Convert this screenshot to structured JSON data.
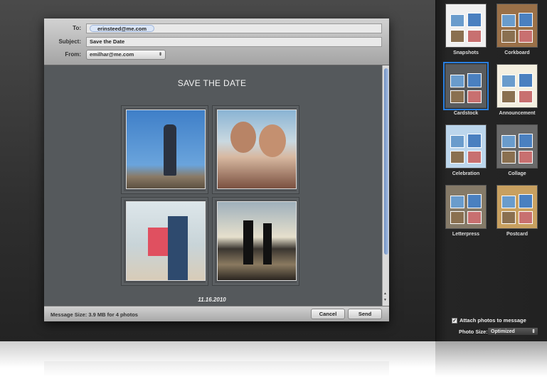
{
  "compose": {
    "to_label": "To:",
    "to_value": "erinsteed@me.com",
    "subject_label": "Subject:",
    "subject_value": "Save the Date",
    "from_label": "From:",
    "from_value": "emilhar@me.com"
  },
  "stationery": {
    "title": "SAVE THE DATE",
    "date": "11.16.2010"
  },
  "footer": {
    "message_size": "Message Size: 3.9 MB for 4 photos",
    "cancel": "Cancel",
    "send": "Send"
  },
  "themes": [
    {
      "label": "Snapshots",
      "bg": "#f0f0f0"
    },
    {
      "label": "Corkboard",
      "bg": "#9a7048"
    },
    {
      "label": "Cardstock",
      "bg": "#5a5c5e",
      "selected": true
    },
    {
      "label": "Announcement",
      "bg": "#f4efe0"
    },
    {
      "label": "Celebration",
      "bg": "#bcd6ec"
    },
    {
      "label": "Collage",
      "bg": "#6a6a6a"
    },
    {
      "label": "Letterpress",
      "bg": "#857a68"
    },
    {
      "label": "Postcard",
      "bg": "#c8a060"
    }
  ],
  "options": {
    "attach_label": "Attach photos to message",
    "attach_checked": true,
    "photo_size_label": "Photo Size:",
    "photo_size_value": "Optimized"
  },
  "colors": {
    "selection": "#2a7fe0",
    "content_bg": "#55595c"
  }
}
